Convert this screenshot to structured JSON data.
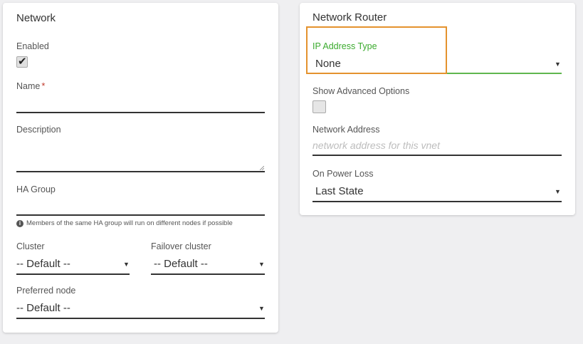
{
  "network": {
    "title": "Network",
    "enabled_label": "Enabled",
    "enabled_checked": true,
    "name_label": "Name",
    "name_required_mark": "*",
    "name_value": "",
    "description_label": "Description",
    "description_value": "",
    "ha_group_label": "HA Group",
    "ha_group_value": "",
    "ha_group_help": "Members of the same HA group will run on different nodes if possible",
    "cluster_label": "Cluster",
    "cluster_value": "-- Default --",
    "failover_cluster_label": "Failover cluster",
    "failover_cluster_value": "-- Default --",
    "preferred_node_label": "Preferred node",
    "preferred_node_value": "-- Default --"
  },
  "router": {
    "title": "Network Router",
    "ip_type_label": "IP Address Type",
    "ip_type_value": "None",
    "show_advanced_label": "Show Advanced Options",
    "show_advanced_checked": false,
    "network_address_label": "Network Address",
    "network_address_placeholder": "network address for this vnet",
    "power_loss_label": "On Power Loss",
    "power_loss_value": "Last State"
  },
  "colors": {
    "accent_green": "#3bab2e",
    "highlight_orange": "#e4922e",
    "required_red": "#c0392b"
  }
}
